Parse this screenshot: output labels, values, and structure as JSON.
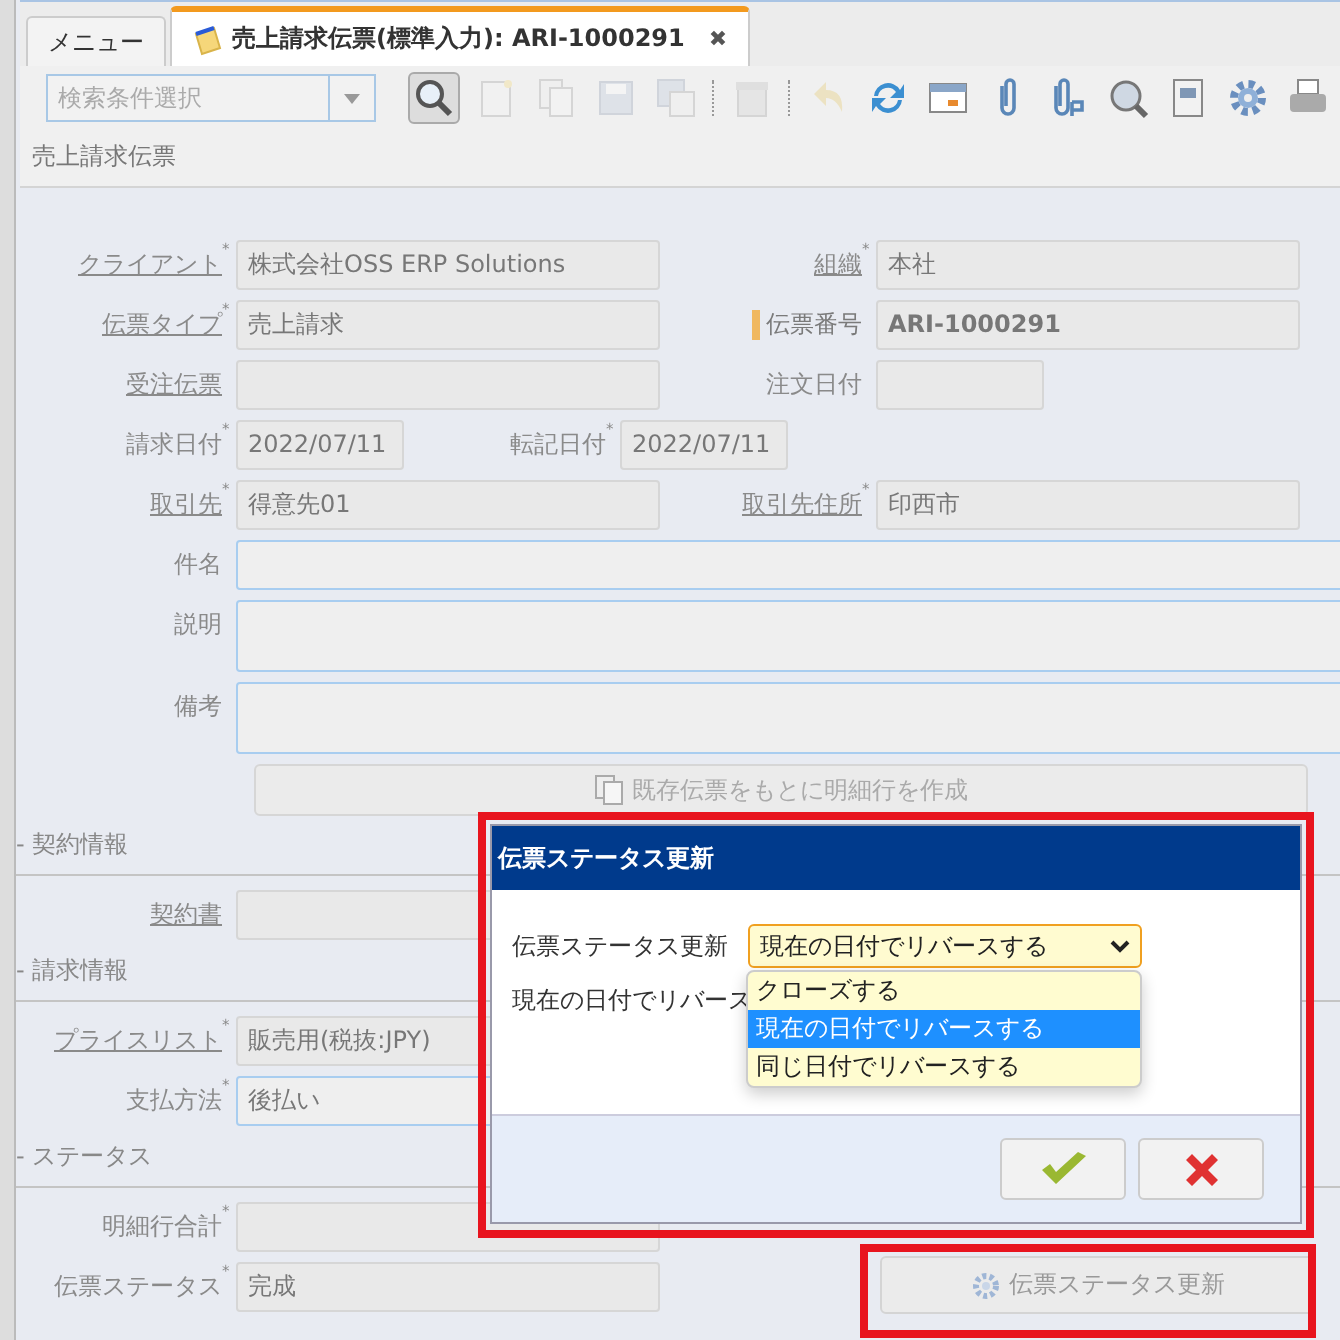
{
  "tabs": [
    {
      "label": "メニュー",
      "selected": false
    },
    {
      "label": "売上請求伝票(標準入力): ARI-1000291",
      "selected": true,
      "close_glyph": "✖"
    }
  ],
  "toolbar": {
    "search_placeholder": "検索条件選択",
    "buttons": [
      {
        "kind": "search",
        "disabled": false
      },
      {
        "kind": "new",
        "disabled": true
      },
      {
        "kind": "copy",
        "disabled": true
      },
      {
        "kind": "save",
        "disabled": true
      },
      {
        "kind": "savecopy",
        "disabled": true
      },
      {
        "kind": "sep"
      },
      {
        "kind": "delete",
        "disabled": true
      },
      {
        "kind": "sep"
      },
      {
        "kind": "undo",
        "disabled": true
      },
      {
        "kind": "refresh",
        "disabled": false
      },
      {
        "kind": "grid",
        "disabled": false
      },
      {
        "kind": "clip",
        "disabled": false
      },
      {
        "kind": "clip2",
        "disabled": false
      },
      {
        "kind": "zoom",
        "disabled": false
      },
      {
        "kind": "report",
        "disabled": false
      },
      {
        "kind": "gear",
        "disabled": false
      },
      {
        "kind": "print",
        "disabled": false
      }
    ]
  },
  "window_title": "売上請求伝票",
  "rows": [
    {
      "kind": "pair",
      "fields": [
        {
          "label": "クライアント",
          "value": "株式会社OSS ERP Solutions",
          "mark": "*",
          "link": true,
          "editable": false,
          "key_field": false,
          "kind": "wide"
        },
        {
          "label": "組織",
          "value": "本社",
          "mark": "*",
          "link": true,
          "editable": false,
          "key_field": false,
          "kind": "wide"
        }
      ]
    },
    {
      "kind": "pair",
      "fields": [
        {
          "label": "伝票タイプ",
          "value": "売上請求",
          "mark": "*",
          "link": true,
          "editable": false,
          "key_field": false,
          "kind": "wide"
        },
        {
          "label": "伝票番号",
          "value": "ARI-1000291",
          "link": false,
          "editable": false,
          "key_field": true,
          "kind": "wide"
        }
      ]
    },
    {
      "kind": "pair",
      "fields": [
        {
          "label": "受注伝票",
          "link": true,
          "editable": false,
          "key_field": false,
          "kind": "wide"
        },
        {
          "label": "注文日付",
          "link": false,
          "editable": false,
          "key_field": false,
          "kind": "short"
        }
      ]
    },
    {
      "kind": "pair",
      "fields": [
        {
          "label": "請求日付",
          "value": "2022/07/11",
          "mark": "*",
          "link": false,
          "editable": false,
          "key_field": false,
          "kind": "short"
        },
        {
          "label": "転記日付",
          "value": "2022/07/11",
          "mark": "*",
          "link": false,
          "editable": false,
          "key_field": false,
          "kind": "short"
        }
      ]
    },
    {
      "kind": "pair",
      "fields": [
        {
          "label": "取引先",
          "value": "得意先01",
          "mark": "*",
          "link": true,
          "editable": false,
          "key_field": false,
          "kind": "wide"
        },
        {
          "label": "取引先住所",
          "value": "印西市",
          "mark": "*",
          "link": true,
          "editable": false,
          "key_field": false,
          "kind": "wide"
        }
      ]
    },
    {
      "kind": "pair",
      "fields": [
        {
          "label": "件名",
          "link": false,
          "editable": true,
          "key_field": false,
          "kind": "full"
        }
      ]
    },
    {
      "kind": "pair",
      "fields": [
        {
          "label": "説明",
          "link": false,
          "editable": true,
          "key_field": false,
          "kind": "tall"
        }
      ]
    },
    {
      "kind": "pair",
      "fields": [
        {
          "label": "備考",
          "link": false,
          "editable": true,
          "key_field": false,
          "kind": "tall"
        }
      ]
    },
    {
      "kind": "button",
      "label": "既存伝票をもとに明細行を作成",
      "disabled": true
    },
    {
      "kind": "section",
      "title": "- 契約情報"
    },
    {
      "kind": "pair",
      "fields": [
        {
          "label": "契約書",
          "link": true,
          "editable": false,
          "key_field": false,
          "kind": "wide"
        }
      ]
    },
    {
      "kind": "section",
      "title": "- 請求情報"
    },
    {
      "kind": "pair",
      "fields": [
        {
          "label": "プライスリスト",
          "value": "販売用(税抜:JPY)",
          "mark": "*",
          "link": true,
          "editable": false,
          "key_field": false,
          "kind": "wide"
        }
      ]
    },
    {
      "kind": "pair",
      "fields": [
        {
          "label": "支払方法",
          "value": "後払い",
          "mark": "*",
          "link": false,
          "editable": true,
          "key_field": false,
          "kind": "wide"
        }
      ]
    },
    {
      "kind": "section",
      "title": "- ステータス"
    },
    {
      "kind": "pair",
      "fields": [
        {
          "label": "明細行合計",
          "mark": "*",
          "link": false,
          "editable": false,
          "key_field": false,
          "kind": "wide"
        }
      ]
    },
    {
      "kind": "pair",
      "fields": [
        {
          "label": "伝票ステータス",
          "value": "完成",
          "mark": "*",
          "link": false,
          "editable": false,
          "key_field": false,
          "kind": "wide"
        }
      ]
    }
  ],
  "status_button": {
    "label": "伝票ステータス更新",
    "disabled": true
  },
  "dialog": {
    "title": "伝票ステータス更新",
    "field_label": "伝票ステータス更新",
    "select_value": "現在の日付でリバースする",
    "note": "現在の日付でリバース",
    "options": [
      {
        "label": "クローズする",
        "selected": false
      },
      {
        "label": "現在の日付でリバースする",
        "selected": true
      },
      {
        "label": "同じ日付でリバースする",
        "selected": false
      }
    ]
  }
}
